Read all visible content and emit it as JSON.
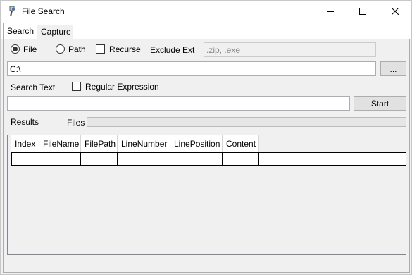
{
  "window": {
    "title": "File Search"
  },
  "tabs": [
    {
      "label": "Search",
      "selected": true
    },
    {
      "label": "Capture",
      "selected": false
    }
  ],
  "options": {
    "file_label": "File",
    "path_label": "Path",
    "recurse_label": "Recurse",
    "exclude_ext_label": "Exclude Ext",
    "exclude_ext_placeholder": ".zip, .exe",
    "file_checked": true,
    "path_checked": false,
    "recurse_checked": false
  },
  "path_field": {
    "value": "C:\\"
  },
  "browse_button": {
    "label": "..."
  },
  "search": {
    "label": "Search Text",
    "regex_label": "Regular Expression",
    "regex_checked": false,
    "value": ""
  },
  "start_button": {
    "label": "Start"
  },
  "results": {
    "label": "Results",
    "files_label": "Files",
    "columns": [
      "Index",
      "FileName",
      "FilePath",
      "LineNumber",
      "LinePosition",
      "Content"
    ]
  },
  "icons": {
    "app": "file-search-app-icon",
    "minimize": "minimize-icon",
    "maximize": "maximize-icon",
    "close": "close-icon"
  }
}
